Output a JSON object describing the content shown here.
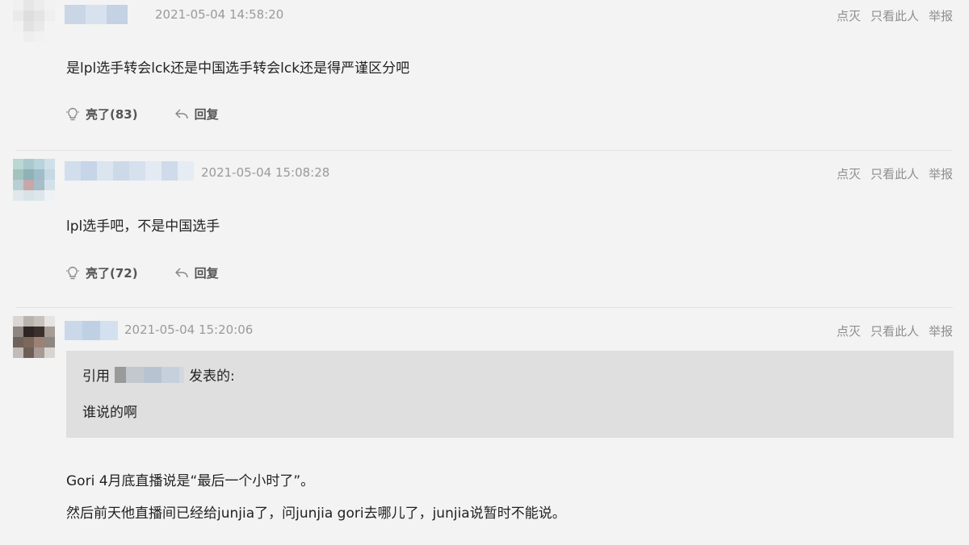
{
  "comments": [
    {
      "timestamp": "2021-05-04 14:58:20",
      "text": "是lpl选手转会lck还是中国选手转会lck还是得严谨区分吧",
      "like_label": "亮了(83)",
      "reply_label": "回复",
      "actions": [
        "点灭",
        "只看此人",
        "举报"
      ]
    },
    {
      "timestamp": "2021-05-04 15:08:28",
      "text": "lpl选手吧，不是中国选手",
      "like_label": "亮了(72)",
      "reply_label": "回复",
      "actions": [
        "点灭",
        "只看此人",
        "举报"
      ]
    },
    {
      "timestamp": "2021-05-04 15:20:06",
      "quote": {
        "prefix": "引用",
        "suffix": "发表的:",
        "text": "谁说的啊"
      },
      "lines": [
        "Gori 4月底直播说是“最后一个小时了”。",
        "然后前天他直播间已经给junjia了，问junjia gori去哪儿了，junjia说暂时不能说。"
      ],
      "actions": [
        "点灭",
        "只看此人",
        "举报"
      ]
    }
  ],
  "icons": {
    "like": "lightbulb-icon",
    "reply": "reply-arrow-icon"
  }
}
